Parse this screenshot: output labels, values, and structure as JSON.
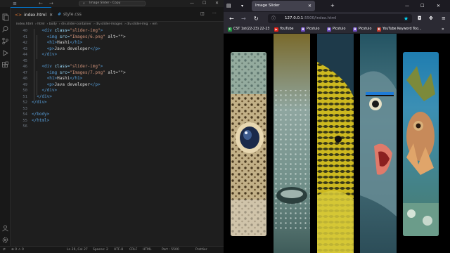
{
  "vscode": {
    "title": "Image Slider - Copy",
    "tabs": [
      {
        "label": "index.html",
        "active": true
      },
      {
        "label": "style.css",
        "active": false
      }
    ],
    "breadcrumb": [
      "index.html",
      "html",
      "body",
      "div.slider-container",
      "div.slider-images",
      "div.slider-img",
      "em"
    ],
    "line_numbers": [
      "40",
      "41",
      "42",
      "43",
      "44",
      "45",
      "46",
      "47",
      "48",
      "49",
      "50",
      "51",
      "52",
      "53",
      "54",
      "55",
      "56"
    ],
    "code_lines": [
      {
        "indent": "    ",
        "tag_open": "<div",
        "attr": " class=",
        "str": "\"slider-img\"",
        "tag_close": ">",
        "text": ""
      },
      {
        "indent": "      ",
        "tag_open": "<img",
        "attr": " src=",
        "str": "\"Images/6.png\"",
        "tag_close": "",
        "text": " alt=\"\">"
      },
      {
        "indent": "      ",
        "tag_open": "<h1>",
        "attr": "",
        "str": "",
        "tag_close": "</h1>",
        "text": "Hashi"
      },
      {
        "indent": "      ",
        "tag_open": "<p>",
        "attr": "",
        "str": "",
        "tag_close": "</p>",
        "text": "Java developer"
      },
      {
        "indent": "    ",
        "tag_open": "</div>",
        "attr": "",
        "str": "",
        "tag_close": "",
        "text": ""
      },
      {
        "indent": "",
        "tag_open": "",
        "attr": "",
        "str": "",
        "tag_close": "",
        "text": ""
      },
      {
        "indent": "    ",
        "tag_open": "<div",
        "attr": " class=",
        "str": "\"slider-img\"",
        "tag_close": ">",
        "text": ""
      },
      {
        "indent": "      ",
        "tag_open": "<img",
        "attr": " src=",
        "str": "\"Images/7.png\"",
        "tag_close": "",
        "text": " alt=\"\">"
      },
      {
        "indent": "      ",
        "tag_open": "<h1>",
        "attr": "",
        "str": "",
        "tag_close": "</h1>",
        "text": "Hashi"
      },
      {
        "indent": "      ",
        "tag_open": "<p>",
        "attr": "",
        "str": "",
        "tag_close": "</p>",
        "text": "Java developer"
      },
      {
        "indent": "    ",
        "tag_open": "</div>",
        "attr": "",
        "str": "",
        "tag_close": "",
        "text": ""
      },
      {
        "indent": "  ",
        "tag_open": "</div>",
        "attr": "",
        "str": "",
        "tag_close": "",
        "text": ""
      },
      {
        "indent": "",
        "tag_open": "</div>",
        "attr": "",
        "str": "",
        "tag_close": "",
        "text": ""
      },
      {
        "indent": "",
        "tag_open": "",
        "attr": "",
        "str": "",
        "tag_close": "",
        "text": ""
      },
      {
        "indent": "",
        "tag_open": "</body>",
        "attr": "",
        "str": "",
        "tag_close": "",
        "text": ""
      },
      {
        "indent": "",
        "tag_open": "</html>",
        "attr": "",
        "str": "",
        "tag_close": "",
        "text": ""
      },
      {
        "indent": "",
        "tag_open": "",
        "attr": "",
        "str": "",
        "tag_close": "",
        "text": ""
      }
    ],
    "status": {
      "cursor": "Ln 26, Col 27",
      "spaces": "Spaces: 2",
      "encoding": "UTF-8",
      "eol": "CRLF",
      "language": "HTML",
      "port": "Port : 5500",
      "prettier": "Prettier",
      "errors": "0",
      "warnings": "0"
    }
  },
  "browser": {
    "tab_title": "Image Slider",
    "url_host": "127.0.0.1",
    "url_path": ":5500/index.html",
    "bookmarks": [
      {
        "label": "CST 1st(22-23) 22-23",
        "badge": "C",
        "color": "#1e8e3e"
      },
      {
        "label": "YouTube",
        "badge": "▶",
        "color": "#e62117"
      },
      {
        "label": "Picstuio",
        "badge": "B",
        "color": "#6d4bbf"
      },
      {
        "label": "Picstuio",
        "badge": "B",
        "color": "#6d4bbf"
      },
      {
        "label": "Picstuio",
        "badge": "B",
        "color": "#6d4bbf"
      },
      {
        "label": "YouTube Keyword Too...",
        "badge": "K",
        "color": "#c0392b"
      }
    ]
  },
  "slider": {
    "images": [
      {
        "name": "pufferfish-eye",
        "base": "#b9a882"
      },
      {
        "name": "porcupinefish",
        "base": "#6e8e86"
      },
      {
        "name": "yellow-spotted-puffer",
        "base": "#c7b21e"
      },
      {
        "name": "grouper-and-cleaner-wrasse",
        "base": "#3c6c7a"
      },
      {
        "name": "scorpionfish-coral",
        "base": "#2e7fa8"
      }
    ]
  }
}
